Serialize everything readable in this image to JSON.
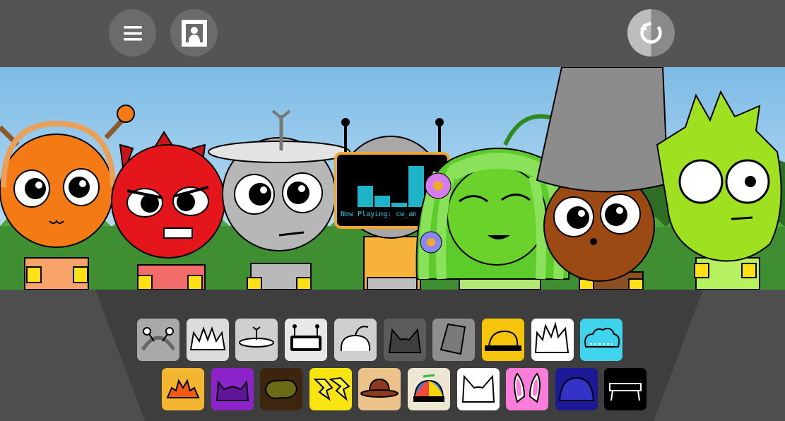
{
  "toolbar": {
    "menu_icon": "hamburger-menu-icon",
    "portrait_icon": "portrait-frame-icon",
    "reset_icon": "reset-cycle-icon"
  },
  "stage": {
    "now_playing": "Now Playing: cw_amer"
  },
  "colors": {
    "topbar": "#545454",
    "tray": "#4e4e4e",
    "button": "#6b6b6b",
    "sky": "#8fc7ec",
    "grass": "#3f8e32",
    "screen_text": "#27d0e6"
  },
  "accessory_slots": {
    "row1": [
      {
        "name": "antenna-headband",
        "bg": "#a9a9a9"
      },
      {
        "name": "spiky-crown",
        "bg": "#dcdcdc"
      },
      {
        "name": "disc-hat",
        "bg": "#cfcfcf"
      },
      {
        "name": "screen-head",
        "bg": "#e8e8e8"
      },
      {
        "name": "sprout-hair",
        "bg": "#cfcfcf"
      },
      {
        "name": "cat-ears-gray",
        "bg": "#5b5b5b"
      },
      {
        "name": "bucket-hat",
        "bg": "#8e8e8e"
      },
      {
        "name": "yellow-cap",
        "bg": "#f6c40b"
      },
      {
        "name": "white-spikes",
        "bg": "#ffffff"
      },
      {
        "name": "blue-cloud",
        "bg": "#3fd4ec"
      }
    ],
    "row2": [
      {
        "name": "orange-burst",
        "bg": "#f4b530"
      },
      {
        "name": "purple-horns",
        "bg": "#8b23c8"
      },
      {
        "name": "brown-bush",
        "bg": "#3d2510"
      },
      {
        "name": "yellow-lightning",
        "bg": "#f8e411"
      },
      {
        "name": "brown-cowboy-hat",
        "bg": "#ecc28b"
      },
      {
        "name": "propeller-cap",
        "bg": "#ece6d2"
      },
      {
        "name": "white-cat-ears",
        "bg": "#ffffff"
      },
      {
        "name": "pink-bunny-ears",
        "bg": "#fa7ed9"
      },
      {
        "name": "blue-dome",
        "bg": "#1b1996"
      },
      {
        "name": "black-bench",
        "bg": "#000000"
      }
    ]
  }
}
